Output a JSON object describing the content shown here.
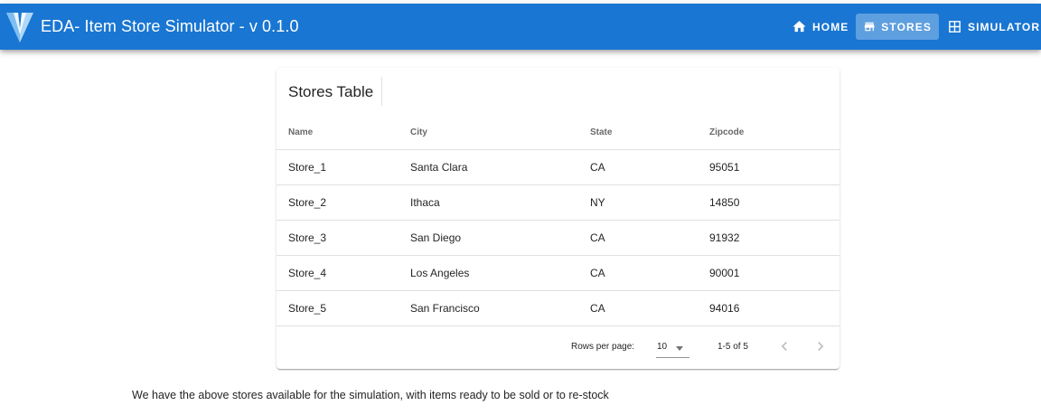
{
  "app": {
    "title": "EDA- Item Store Simulator - v 0.1.0",
    "logo_icon": "vuetify-logo-icon",
    "bar_color": "#1976d2"
  },
  "nav": [
    {
      "label": "HOME",
      "icon": "home-icon",
      "active": false
    },
    {
      "label": "STORES",
      "icon": "store-icon",
      "active": true
    },
    {
      "label": "SIMULATOR",
      "icon": "grid-table-icon",
      "active": false
    }
  ],
  "card": {
    "title": "Stores Table"
  },
  "table": {
    "columns": [
      "Name",
      "City",
      "State",
      "Zipcode"
    ],
    "rows": [
      [
        "Store_1",
        "Santa Clara",
        "CA",
        "95051"
      ],
      [
        "Store_2",
        "Ithaca",
        "NY",
        "14850"
      ],
      [
        "Store_3",
        "San Diego",
        "CA",
        "91932"
      ],
      [
        "Store_4",
        "Los Angeles",
        "CA",
        "90001"
      ],
      [
        "Store_5",
        "San Francisco",
        "CA",
        "94016"
      ]
    ]
  },
  "pagination": {
    "rows_per_page_label": "Rows per page:",
    "rows_per_page_value": "10",
    "page_info": "1-5 of 5",
    "prev_icon": "chevron-left-icon",
    "next_icon": "chevron-right-icon"
  },
  "note": "We have the above stores available for the simulation, with items ready to be sold or to re-stock"
}
